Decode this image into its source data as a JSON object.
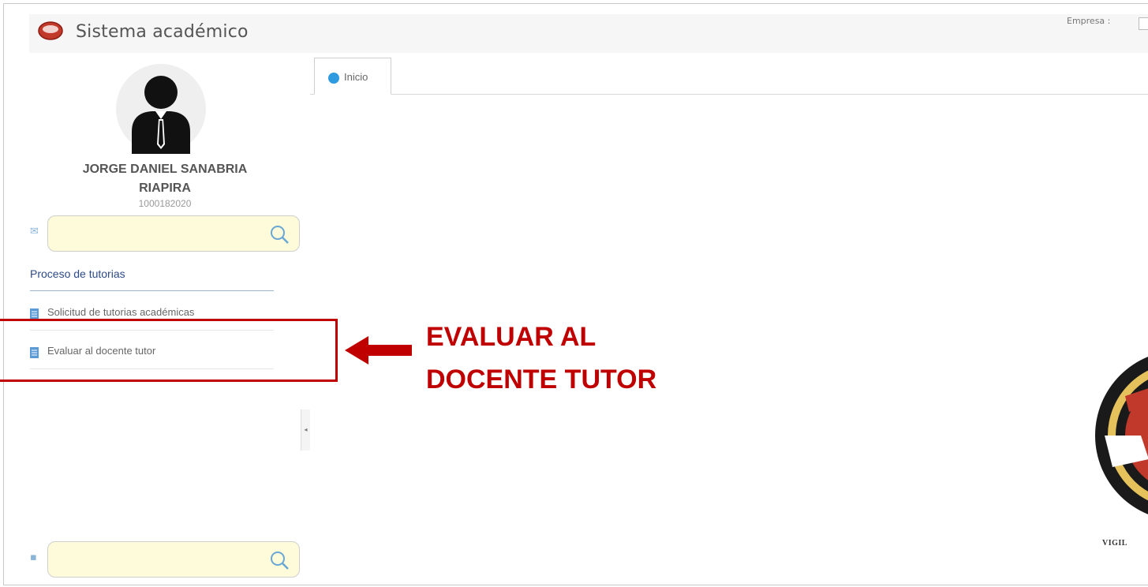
{
  "header": {
    "app_title": "Sistema académico",
    "empresa_label": "Empresa :"
  },
  "user": {
    "name_line1": "JORGE DANIEL SANABRIA",
    "name_line2": "RIAPIRA",
    "id": "1000182020"
  },
  "sidebar": {
    "search_top": {
      "value": "",
      "placeholder": ""
    },
    "search_bottom": {
      "value": "",
      "placeholder": ""
    },
    "section_title": "Proceso de tutorias",
    "items": [
      {
        "label": "Solicitud de tutorias académicas",
        "icon": "list-icon"
      },
      {
        "label": "Evaluar al docente tutor",
        "icon": "list-icon"
      }
    ]
  },
  "tabs": [
    {
      "label": "Inicio",
      "active": true,
      "icon": "circle-icon"
    }
  ],
  "annotation": {
    "line1": "EVALUAR AL",
    "line2": "DOCENTE TUTOR",
    "color": "#c00000"
  },
  "emblem": {
    "caption": "VIGIL"
  },
  "colors": {
    "accent": "#2e9be0",
    "annotation": "#c00000",
    "search_bg": "#fdfbd9",
    "menu_icon": "#5b9bd5"
  }
}
